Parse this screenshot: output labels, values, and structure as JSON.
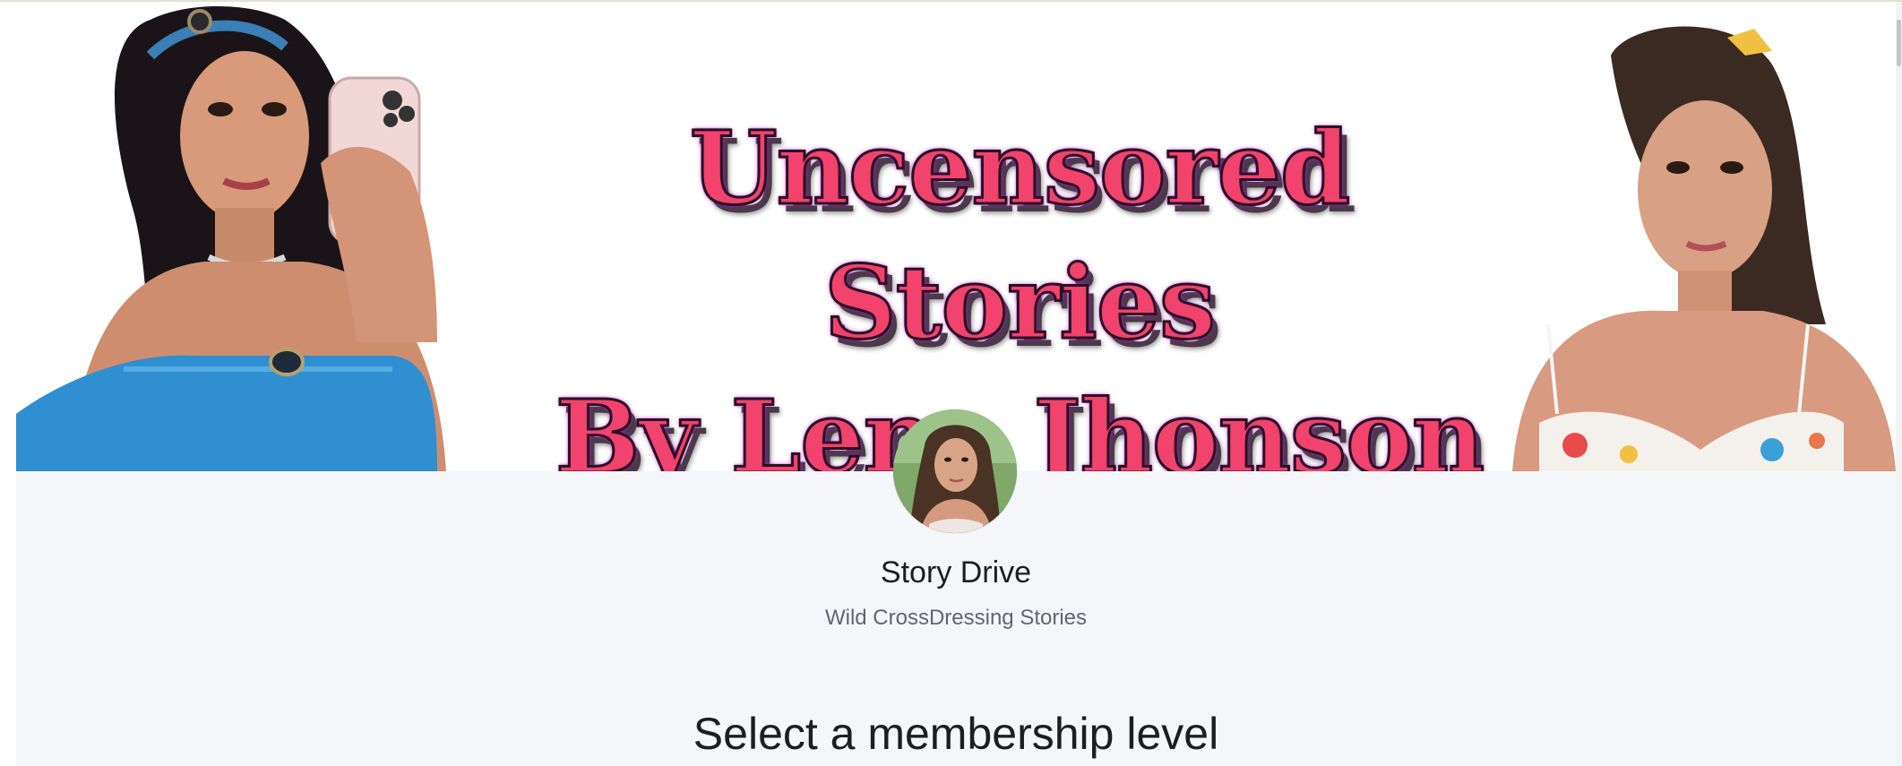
{
  "banner": {
    "title_line1": "Uncensored Stories",
    "title_line2": "By Lena Jhonson",
    "accent_color": "#f2426e",
    "glow_color": "#c21be0"
  },
  "creator": {
    "name": "Story Drive",
    "tagline": "Wild CrossDressing Stories"
  },
  "membership": {
    "heading": "Select a membership level"
  }
}
